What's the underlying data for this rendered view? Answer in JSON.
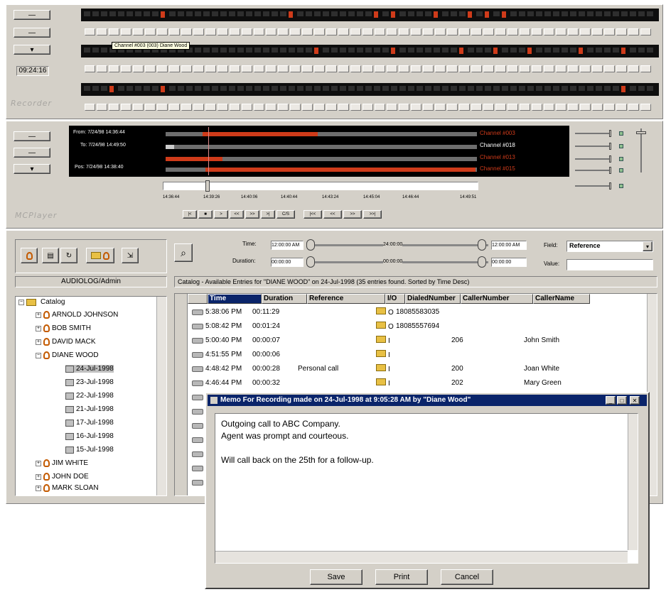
{
  "recorder": {
    "time": "09:24:16",
    "label": "Recorder",
    "tooltip": "Channel #003 (003) Diane Wood"
  },
  "player": {
    "label": "MCPlayer",
    "from": "From:  7/24/98 14:36:44",
    "to": "To:  7/24/98 14:49:50",
    "pos": "Pos:  7/24/98 14:38:40",
    "channels": [
      "Channel #003",
      "Channel #018",
      "Channel #013",
      "Channel #015"
    ],
    "ticks": [
      "14:36:44",
      "14:39:26",
      "14:40:06",
      "14:40:44",
      "14:43:24",
      "14:45:04",
      "14:46:44",
      "14:49:51"
    ],
    "transport": [
      "|<",
      "■",
      ">",
      "<<",
      ">>",
      ">|",
      "C/S",
      "|<<",
      "<<",
      ">>",
      ">>|"
    ]
  },
  "search": {
    "time_label": "Time:",
    "time_start": "12:00:00 AM",
    "time_mid": "24:00:00",
    "time_end": "12:00:00 AM",
    "duration_label": "Duration:",
    "dur_start": "00:00:00",
    "dur_mid": "00:00:00",
    "dur_end": "00:00:00",
    "field_label": "Field:",
    "field_value": "Reference",
    "value_label": "Value:",
    "value_value": ""
  },
  "sidebar": {
    "server": "AUDIOLOG/Admin",
    "catalog_label": "Catalog",
    "users": [
      "ARNOLD JOHNSON",
      "BOB SMITH",
      "DAVID MACK",
      "DIANE WOOD"
    ],
    "dates": [
      "24-Jul-1998",
      "23-Jul-1998",
      "22-Jul-1998",
      "21-Jul-1998",
      "17-Jul-1998",
      "16-Jul-1998",
      "15-Jul-1998"
    ],
    "more_users": [
      "JIM WHITE",
      "JOHN DOE",
      "MARK SLOAN"
    ]
  },
  "catalog": {
    "status": "Catalog - Available Entries for \"DIANE WOOD\" on 24-Jul-1998 (35 entries found. Sorted by Time Desc)",
    "columns": [
      "Time",
      "Duration",
      "Reference",
      "I/O",
      "DialedNumber",
      "CallerNumber",
      "CallerName"
    ],
    "rows": [
      {
        "time": "5:38:06 PM",
        "duration": "00:11:29",
        "reference": "",
        "io": "O",
        "dialed": "18085583035",
        "caller": "",
        "name": ""
      },
      {
        "time": "5:08:42 PM",
        "duration": "00:01:24",
        "reference": "",
        "io": "O",
        "dialed": "18085557694",
        "caller": "",
        "name": ""
      },
      {
        "time": "5:00:40 PM",
        "duration": "00:00:07",
        "reference": "",
        "io": "I",
        "dialed": "",
        "caller": "206",
        "name": "John Smith"
      },
      {
        "time": "4:51:55 PM",
        "duration": "00:00:06",
        "reference": "",
        "io": "I",
        "dialed": "",
        "caller": "",
        "name": ""
      },
      {
        "time": "4:48:42 PM",
        "duration": "00:00:28",
        "reference": "Personal call",
        "io": "I",
        "dialed": "",
        "caller": "200",
        "name": "Joan White"
      },
      {
        "time": "4:46:44 PM",
        "duration": "00:00:32",
        "reference": "",
        "io": "I",
        "dialed": "",
        "caller": "202",
        "name": "Mary Green"
      }
    ]
  },
  "memo_dialog": {
    "title": "Memo For Recording made on 24-Jul-1998 at 9:05:28 AM by \"Diane Wood\"",
    "line1": "Outgoing call to ABC Company.",
    "line2": "Agent was prompt and courteous.",
    "line3": "",
    "line4": "Will call back on the 25th for a follow-up.",
    "save": "Save",
    "print": "Print",
    "cancel": "Cancel"
  }
}
